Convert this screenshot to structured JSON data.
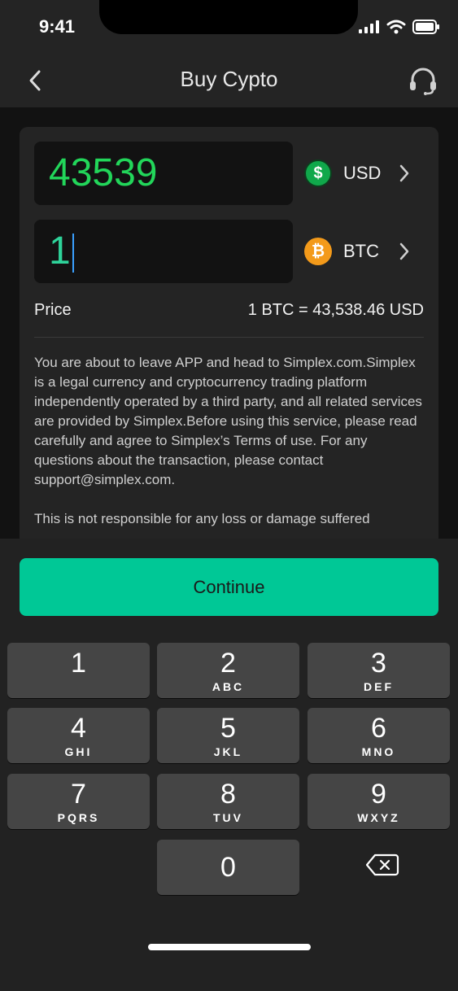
{
  "status": {
    "time": "9:41"
  },
  "nav": {
    "title": "Buy Cypto"
  },
  "usd": {
    "amount": "43539",
    "currency": "USD"
  },
  "btc": {
    "amount": "1",
    "currency": "BTC"
  },
  "price": {
    "label": "Price",
    "value": "1 BTC = 43,538.46 USD"
  },
  "disclaimer": {
    "p1": "You are about to leave APP and head to Simplex.com.Simplex is a legal currency and cryptocurrency trading platform independently operated by a third party, and all related services are provided by Simplex.Before using this service, please read carefully and agree to Simplex’s Terms of use. For any questions about the transaction, please contact support@simplex.com.",
    "p2": "This is not responsible for any loss or damage suffered"
  },
  "continue_label": "Continue",
  "keypad": [
    {
      "digit": "1",
      "letters": ""
    },
    {
      "digit": "2",
      "letters": "ABC"
    },
    {
      "digit": "3",
      "letters": "DEF"
    },
    {
      "digit": "4",
      "letters": "GHI"
    },
    {
      "digit": "5",
      "letters": "JKL"
    },
    {
      "digit": "6",
      "letters": "MNO"
    },
    {
      "digit": "7",
      "letters": "PQRS"
    },
    {
      "digit": "8",
      "letters": "TUV"
    },
    {
      "digit": "9",
      "letters": "WXYZ"
    },
    {
      "digit": "0",
      "letters": ""
    }
  ],
  "colors": {
    "accent": "#00c896",
    "usd_green": "#22d65a",
    "btc_orange": "#f39a1a"
  }
}
